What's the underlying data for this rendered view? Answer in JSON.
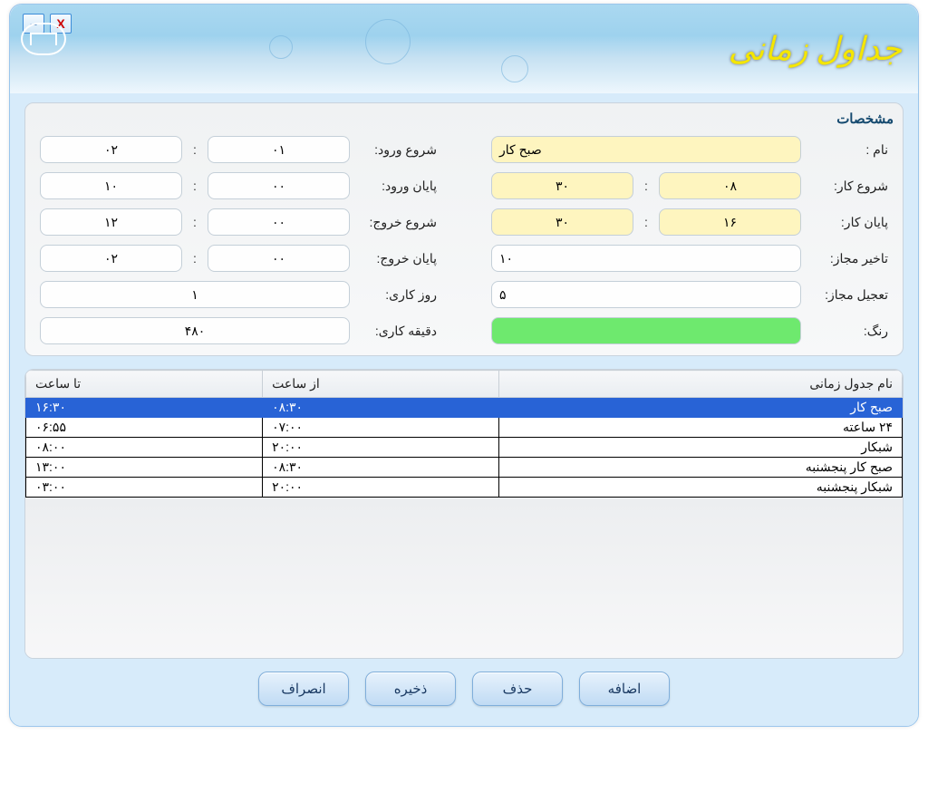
{
  "window": {
    "title": "جداول زمانی"
  },
  "panel": {
    "title": "مشخصات"
  },
  "labels": {
    "name": "نام :",
    "work_start": "شروع کار:",
    "work_end": "پایان کار:",
    "allowed_delay": "تاخیر مجاز:",
    "allowed_early": "تعجیل مجاز:",
    "color": "رنگ:",
    "entry_start": "شروع ورود:",
    "entry_end": "پایان ورود:",
    "exit_start": "شروع خروج:",
    "exit_end": "پایان خروج:",
    "work_day": "روز کاری:",
    "work_minutes": "دقیقه کاری:"
  },
  "values": {
    "name": "صبح کار",
    "work_start_h": "۰۸",
    "work_start_m": "۳۰",
    "work_end_h": "۱۶",
    "work_end_m": "۳۰",
    "allowed_delay": "۱۰",
    "allowed_early": "۵",
    "entry_start_h": "۰۱",
    "entry_start_m": "۰۲",
    "entry_end_h": "۰۰",
    "entry_end_m": "۱۰",
    "exit_start_h": "۰۰",
    "exit_start_m": "۱۲",
    "exit_end_h": "۰۰",
    "exit_end_m": "۰۲",
    "work_day": "۱",
    "work_minutes": "۴۸۰"
  },
  "grid": {
    "headers": {
      "name": "نام جدول زمانی",
      "from": "از ساعت",
      "to": "تا ساعت"
    },
    "rows": [
      {
        "name": "صبح کار",
        "from": "۰۸:۳۰",
        "to": "۱۶:۳۰",
        "selected": true
      },
      {
        "name": "۲۴ ساعته",
        "from": "۰۷:۰۰",
        "to": "۰۶:۵۵"
      },
      {
        "name": "شبکار",
        "from": "۲۰:۰۰",
        "to": "۰۸:۰۰"
      },
      {
        "name": "صبح کار پنجشنبه",
        "from": "۰۸:۳۰",
        "to": "۱۳:۰۰"
      },
      {
        "name": "شبکار پنجشنبه",
        "from": "۲۰:۰۰",
        "to": "۰۳:۰۰"
      }
    ]
  },
  "buttons": {
    "add": "اضافه",
    "delete": "حذف",
    "save": "ذخیره",
    "cancel": "انصراف"
  }
}
